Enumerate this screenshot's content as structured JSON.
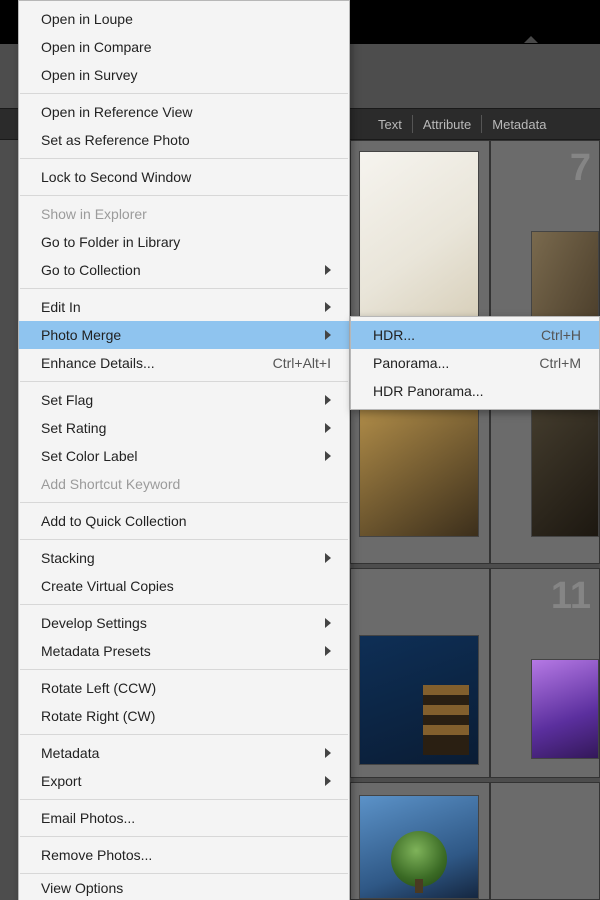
{
  "filterbar": {
    "text": "Text",
    "attribute": "Attribute",
    "metadata": "Metadata"
  },
  "cells": {
    "n7": "7",
    "n11": "11"
  },
  "menu": {
    "open_in_loupe": "Open in Loupe",
    "open_in_compare": "Open in Compare",
    "open_in_survey": "Open in Survey",
    "open_in_reference": "Open in Reference View",
    "set_as_reference": "Set as Reference Photo",
    "lock_second_window": "Lock to Second Window",
    "show_in_explorer": "Show in Explorer",
    "go_to_folder": "Go to Folder in Library",
    "go_to_collection": "Go to Collection",
    "edit_in": "Edit In",
    "photo_merge": "Photo Merge",
    "enhance_details": "Enhance Details...",
    "enhance_details_accel": "Ctrl+Alt+I",
    "set_flag": "Set Flag",
    "set_rating": "Set Rating",
    "set_color": "Set Color Label",
    "add_shortcut_kw": "Add Shortcut Keyword",
    "add_quick_coll": "Add to Quick Collection",
    "stacking": "Stacking",
    "create_virtual": "Create Virtual Copies",
    "develop_settings": "Develop Settings",
    "metadata_presets": "Metadata Presets",
    "rotate_left": "Rotate Left (CCW)",
    "rotate_right": "Rotate Right (CW)",
    "metadata": "Metadata",
    "export": "Export",
    "email_photos": "Email Photos...",
    "remove_photos": "Remove Photos...",
    "view_options": "View Options"
  },
  "submenu": {
    "hdr": "HDR...",
    "hdr_accel": "Ctrl+H",
    "panorama": "Panorama...",
    "panorama_accel": "Ctrl+M",
    "hdr_panorama": "HDR Panorama..."
  }
}
